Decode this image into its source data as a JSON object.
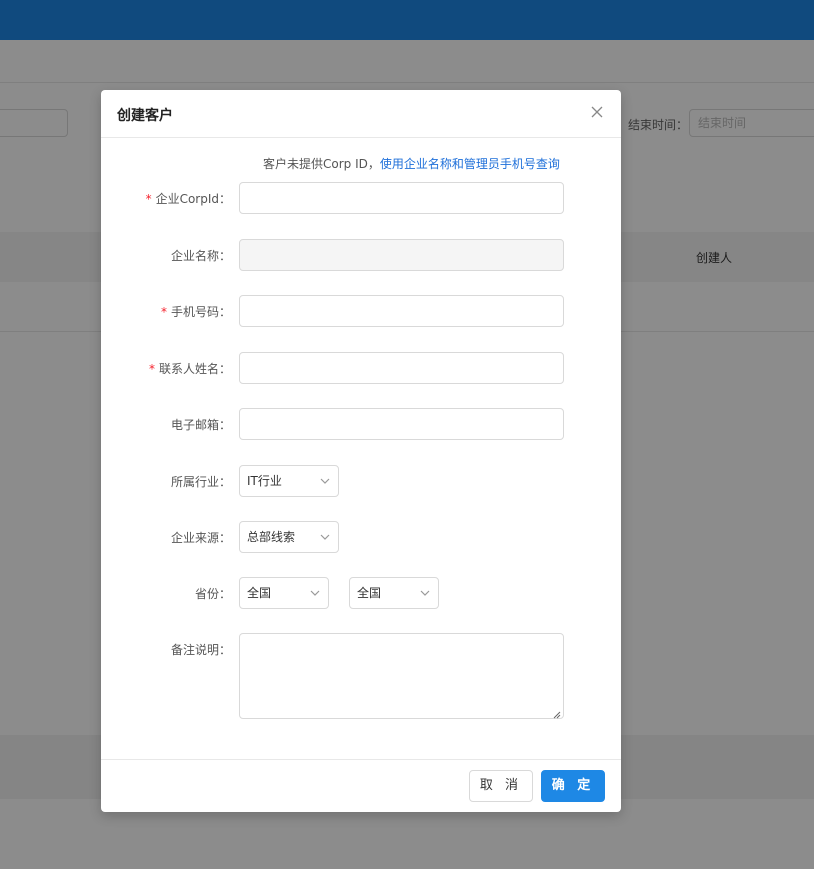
{
  "background": {
    "end_time_label": "结束时间：",
    "end_time_placeholder": "结束时间",
    "column_creator": "创建人"
  },
  "modal": {
    "title": "创建客户",
    "close_icon": "close-icon",
    "hint_text": "客户未提供Corp ID，",
    "hint_link": "使用企业名称和管理员手机号查询",
    "fields": {
      "corp_id": {
        "label": "企业CorpId：",
        "required": true,
        "value": ""
      },
      "company_name": {
        "label": "企业名称：",
        "required": false,
        "value": "",
        "disabled": true
      },
      "phone": {
        "label": "手机号码：",
        "required": true,
        "value": ""
      },
      "contact_name": {
        "label": "联系人姓名：",
        "required": true,
        "value": ""
      },
      "email": {
        "label": "电子邮箱：",
        "required": false,
        "value": ""
      },
      "industry": {
        "label": "所属行业：",
        "selected": "IT行业"
      },
      "source": {
        "label": "企业来源：",
        "selected": "总部线索"
      },
      "province": {
        "label": "省份：",
        "selected_1": "全国",
        "selected_2": "全国"
      },
      "remark": {
        "label": "备注说明：",
        "value": ""
      }
    },
    "footer": {
      "cancel_label": "取 消",
      "ok_label": "确 定"
    }
  },
  "colors": {
    "primary": "#1e88e5",
    "required": "#f5222d",
    "link": "#1e6fd9"
  }
}
